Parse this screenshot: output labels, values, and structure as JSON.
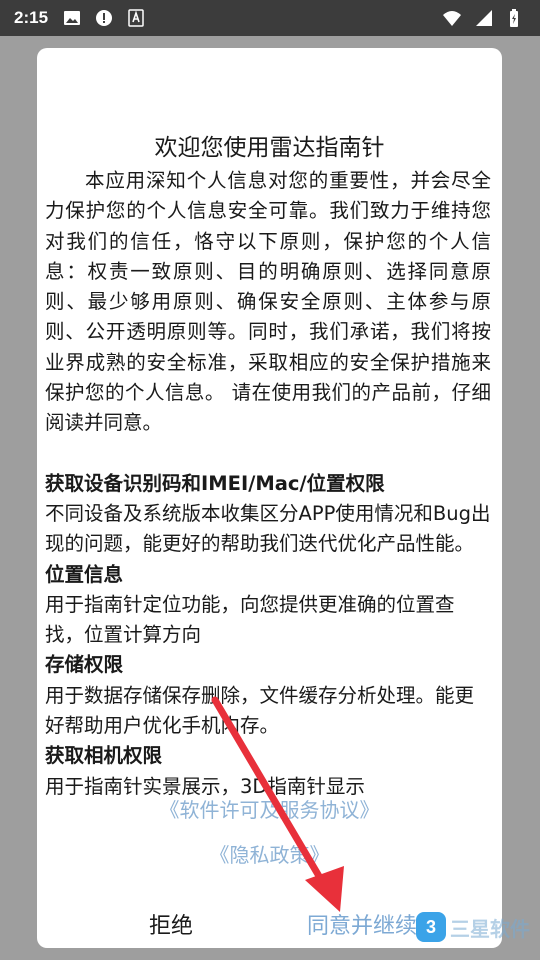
{
  "status_bar": {
    "time": "2:15",
    "icons_left": [
      "image-icon",
      "alert-icon",
      "text-icon"
    ],
    "icons_right": [
      "wifi-icon",
      "signal-icon",
      "battery-charging-icon"
    ]
  },
  "dialog": {
    "title": "欢迎您使用雷达指南针",
    "intro": "本应用深知个人信息对您的重要性，并会尽全力保护您的个人信息安全可靠。我们致力于维持您对我们的信任，恪守以下原则，保护您的个人信息：权责一致原则、目的明确原则、选择同意原则、最少够用原则、确保安全原则、主体参与原则、公开透明原则等。同时，我们承诺，我们将按业界成熟的安全标准，采取相应的安全保护措施来保护您的个人信息。 请在使用我们的产品前，仔细阅读并同意。",
    "sections": [
      {
        "title": "获取设备识别码和IMEI/Mac/位置权限",
        "body": "不同设备及系统版本收集区分APP使用情况和Bug出现的问题，能更好的帮助我们迭代优化产品性能。"
      },
      {
        "title": "位置信息",
        "body": "用于指南针定位功能，向您提供更准确的位置查找，位置计算方向"
      },
      {
        "title": "存储权限",
        "body": "用于数据存储保存删除，文件缓存分析处理。能更好帮助用户优化手机内存。"
      },
      {
        "title": "获取相机权限",
        "body": "用于指南针实景展示，3D指南针显示"
      }
    ],
    "link_license": "《软件许可及服务协议》",
    "link_privacy": "《隐私政策》",
    "refuse_label": "拒绝",
    "agree_label": "同意并继续"
  },
  "watermark": {
    "logo": "3",
    "text": "三星软件"
  },
  "colors": {
    "status_bar": "#3c3c3c",
    "scrim": "#9e9e9e",
    "link": "#8fb3d6",
    "agree": "#7da9d4",
    "arrow": "#e8303a"
  }
}
